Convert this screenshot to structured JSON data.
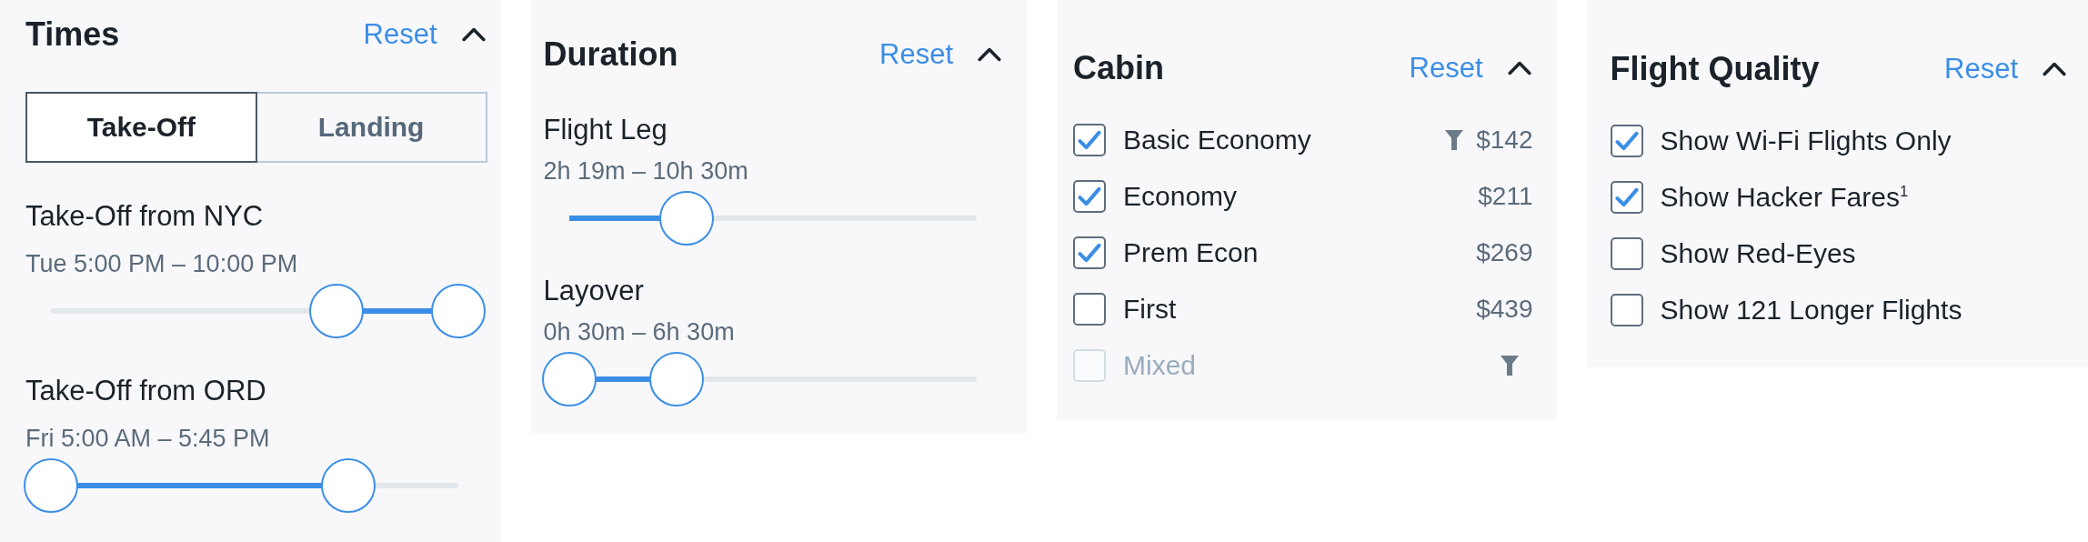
{
  "panels": [
    {
      "kind": "times",
      "title": "Times",
      "reset": "Reset",
      "expanded": true,
      "tabs": [
        {
          "label": "Take-Off",
          "selected": true
        },
        {
          "label": "Landing",
          "selected": false
        }
      ],
      "sliders": [
        {
          "label": "Take-Off from NYC",
          "range": "Tue 5:00 PM – 10:00 PM",
          "thumbs": [
            {
              "level": 0.7
            },
            {
              "level": 1
            }
          ]
        },
        {
          "label": "Take-Off from ORD",
          "range": "Fri 5:00 AM – 5:45 PM",
          "thumbs": [
            {
              "level": 0
            },
            {
              "level": 0.73
            }
          ]
        }
      ]
    },
    {
      "kind": "sliders",
      "title": "Duration",
      "reset": "Reset",
      "expanded": true,
      "sliders": [
        {
          "label": "Flight Leg",
          "range": "2h 19m – 10h 30m",
          "thumbs": [
            {
              "level": 0.29
            }
          ]
        },
        {
          "label": "Layover",
          "range": "0h 30m – 6h 30m",
          "thumbs": [
            {
              "level": 0
            },
            {
              "level": 0.265
            }
          ]
        }
      ]
    },
    {
      "kind": "checklist",
      "title": "Cabin",
      "reset": "Reset",
      "expanded": true,
      "items": [
        {
          "label": "Basic Economy",
          "checked": true,
          "disabled": false,
          "filtered": true,
          "price": "$142"
        },
        {
          "label": "Economy",
          "checked": true,
          "disabled": false,
          "filtered": false,
          "price": "$211"
        },
        {
          "label": "Prem Econ",
          "checked": true,
          "disabled": false,
          "filtered": false,
          "price": "$269"
        },
        {
          "label": "First",
          "checked": false,
          "disabled": false,
          "filtered": false,
          "price": "$439"
        },
        {
          "label": "Mixed",
          "checked": false,
          "disabled": true,
          "filtered": true
        }
      ]
    },
    {
      "kind": "checklist",
      "title": "Flight Quality",
      "reset": "Reset",
      "expanded": true,
      "items": [
        {
          "label": "Show Wi-Fi Flights Only",
          "checked": true
        },
        {
          "label": "Show Hacker Fares$^{1}$",
          "checked": true
        },
        {
          "label": "Show Red-Eyes",
          "checked": false
        },
        {
          "label": "Show 121 Longer Flights",
          "checked": false
        }
      ]
    }
  ]
}
